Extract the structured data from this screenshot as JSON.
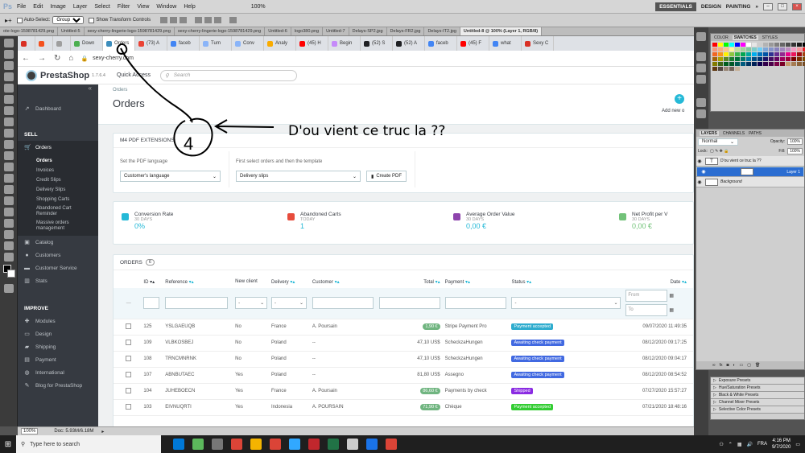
{
  "photoshop": {
    "menu": [
      "File",
      "Edit",
      "Image",
      "Layer",
      "Select",
      "Filter",
      "View",
      "Window",
      "Help"
    ],
    "zoom": "100%",
    "workspaces": [
      "ESSENTIALS",
      "DESIGN",
      "PAINTING"
    ],
    "options": {
      "auto_select": "Auto-Select:",
      "auto_select_value": "Group",
      "show_transform": "Show Transform Controls"
    },
    "doc_tabs": [
      "ote-logo-1598781429.png",
      "Untitled-5",
      "sexy-cherry-lingerie-logo-1598781429.png",
      "sexy-cherry-lingerie-logo-1598781429.png",
      "Untitled-6",
      "logo380.png",
      "Untitled-7",
      "Delays-SP2.jpg",
      "Delays-FR2.jpg",
      "Delays-IT2.jpg",
      "Untitled-8 @ 100% (Layer 1, RGB/8)"
    ],
    "status": {
      "zoom": "100%",
      "doc": "Doc: 5.93M/6.18M"
    },
    "panels": {
      "swatch_tabs": [
        "COLOR",
        "SWATCHES",
        "STYLES"
      ],
      "layer_tabs": [
        "LAYERS",
        "CHANNELS",
        "PATHS"
      ],
      "blend": "Normal",
      "opacity_label": "Opacity:",
      "opacity": "100%",
      "lock_label": "Lock:",
      "fill_label": "Fill:",
      "fill": "100%",
      "layers": [
        {
          "name": "D'ou vient ce truc la ??",
          "type": "T",
          "selected": false
        },
        {
          "name": "Layer 1",
          "type": "",
          "selected": true
        },
        {
          "name": "Background",
          "type": "",
          "selected": false
        }
      ],
      "presets": [
        "Exposure Presets",
        "Hue/Saturation Presets",
        "Black & White Presets",
        "Channel Mixer Presets",
        "Selective Color Presets"
      ]
    },
    "swatch_colors": [
      "#ff0000",
      "#ffff00",
      "#00ff00",
      "#00ffff",
      "#0000ff",
      "#ff00ff",
      "#ffffff",
      "#e6e6e6",
      "#cccccc",
      "#b3b3b3",
      "#999999",
      "#808080",
      "#666666",
      "#4d4d4d",
      "#333333",
      "#1a1a1a",
      "#000000",
      "#f7977a",
      "#f9ad81",
      "#fdc68a",
      "#fff79a",
      "#c4df9b",
      "#a2d39c",
      "#82ca9d",
      "#7bcdc8",
      "#6ecff6",
      "#7ea7d8",
      "#8493ca",
      "#8882be",
      "#a187be",
      "#bc8dbf",
      "#f49ac2",
      "#f6989d",
      "#ed1c24",
      "#f26522",
      "#f7941d",
      "#fff200",
      "#8dc63f",
      "#39b54a",
      "#00a651",
      "#00a99d",
      "#00aeef",
      "#0072bc",
      "#0054a6",
      "#2e3192",
      "#662d91",
      "#92278f",
      "#ec008c",
      "#ed145b",
      "#9e0b0f",
      "#a0410d",
      "#a36209",
      "#aba000",
      "#598527",
      "#1a7b30",
      "#007236",
      "#00746b",
      "#0076a3",
      "#004a80",
      "#003471",
      "#1b1464",
      "#440e62",
      "#630460",
      "#9e005d",
      "#9e0039",
      "#790000",
      "#7b2e00",
      "#7d4900",
      "#827b00",
      "#406618",
      "#005e20",
      "#005826",
      "#005952",
      "#005b7f",
      "#003663",
      "#002157",
      "#0d004c",
      "#32004b",
      "#4b0049",
      "#7b0046",
      "#7a0026",
      "#c69c6d",
      "#a67c52",
      "#8c6239",
      "#754c24",
      "#603913",
      "#534741",
      "#998675",
      "#736357",
      "#c7b299"
    ]
  },
  "annotation": {
    "number": "4",
    "text": "D'ou vient ce truc la ??"
  },
  "browser": {
    "tabs": [
      {
        "label": "",
        "color": "#d93025"
      },
      {
        "label": "",
        "color": "#f4511e"
      },
      {
        "label": "",
        "color": "#9e9e9e"
      },
      {
        "label": "Down",
        "color": "#4caf50"
      },
      {
        "label": "Orders",
        "color": "#3c8dbc"
      },
      {
        "label": "(73) A",
        "color": "#ea4335"
      },
      {
        "label": "faceb",
        "color": "#4285f4"
      },
      {
        "label": "Turn",
        "color": "#8ab4f8"
      },
      {
        "label": "Conv",
        "color": "#8ab4f8"
      },
      {
        "label": "Analy",
        "color": "#f9ab00"
      },
      {
        "label": "(45) H",
        "color": "#ff0000"
      },
      {
        "label": "Begin",
        "color": "#c58af9"
      },
      {
        "label": "(52) S",
        "color": "#202124"
      },
      {
        "label": "(52) A",
        "color": "#202124"
      },
      {
        "label": "faceb",
        "color": "#4285f4"
      },
      {
        "label": "(45) F",
        "color": "#ff0000"
      },
      {
        "label": "what",
        "color": "#4285f4"
      },
      {
        "label": "Sexy C",
        "color": "#d93025"
      }
    ],
    "url": "sexy-cherry.com"
  },
  "prestashop": {
    "brand": "PrestaShop",
    "version": "1.7.6.4",
    "quick_access": "Quick Access",
    "search_placeholder": "Search",
    "breadcrumb": "Orders",
    "page_title": "Orders",
    "add_new": "Add new o",
    "sidebar": {
      "dashboard": "Dashboard",
      "sell": "SELL",
      "orders": "Orders",
      "order_subs": [
        "Orders",
        "Invoices",
        "Credit Slips",
        "Delivery Slips",
        "Shopping Carts",
        "Abandoned Cart Reminder",
        "Massive orders management"
      ],
      "catalog": "Catalog",
      "customers": "Customers",
      "customer_service": "Customer Service",
      "stats": "Stats",
      "improve": "IMPROVE",
      "improve_items": [
        "Modules",
        "Design",
        "Shipping",
        "Payment",
        "International",
        "Blog for PrestaShop"
      ]
    },
    "pdf": {
      "title": "M4 PDF EXTENSIONS",
      "lang_label": "Set the PDF language",
      "lang_value": "Customer's language",
      "tpl_label": "First select orders and then the template",
      "tpl_value": "Delivery slips",
      "create_button": "Create PDF"
    },
    "kpis": [
      {
        "title": "Conversion Rate",
        "sub": "30 DAYS",
        "value": "0%",
        "color": "#25b9d7"
      },
      {
        "title": "Abandoned Carts",
        "sub": "TODAY",
        "value": "1",
        "color": "#e74c3c"
      },
      {
        "title": "Average Order Value",
        "sub": "30 DAYS",
        "value": "0,00 €",
        "color": "#8e44ad"
      },
      {
        "title": "Net Profit per V",
        "sub": "30 DAYS",
        "value": "0,00 €",
        "color": "#72c279"
      }
    ],
    "orders": {
      "title": "ORDERS",
      "count": "6",
      "columns": [
        "ID",
        "Reference",
        "New client",
        "Delivery",
        "Customer",
        "Total",
        "Payment",
        "Status",
        "Date"
      ],
      "filters": {
        "from": "From",
        "to": "To",
        "dash": "-"
      },
      "rows": [
        {
          "id": "125",
          "ref": "YSLGAEUQB",
          "new": "No",
          "delivery": "France",
          "customer": "A. Poursain",
          "total": "1,90 €",
          "total_badge": true,
          "payment": "Stripe Payment Pro",
          "status": "Payment accepted",
          "status_color": "#2eacce",
          "date": "09/07/2020 11:49:35"
        },
        {
          "id": "109",
          "ref": "VLBKOSBEJ",
          "new": "No",
          "delivery": "Poland",
          "customer": "--",
          "total": "47,10 US$",
          "total_badge": false,
          "payment": "ScheckzaHungen",
          "status": "Awaiting check payment",
          "status_color": "#4169e1",
          "date": "08/12/2020 09:17:25"
        },
        {
          "id": "108",
          "ref": "TRNCMNRNK",
          "new": "No",
          "delivery": "Poland",
          "customer": "--",
          "total": "47,10 US$",
          "total_badge": false,
          "payment": "ScheckzaHungen",
          "status": "Awaiting check payment",
          "status_color": "#4169e1",
          "date": "08/12/2020 09:04:17"
        },
        {
          "id": "107",
          "ref": "ABNBUTAEC",
          "new": "Yes",
          "delivery": "Poland",
          "customer": "--",
          "total": "81,80 US$",
          "total_badge": false,
          "payment": "Assegno",
          "status": "Awaiting check payment",
          "status_color": "#4169e1",
          "date": "08/12/2020 08:54:52"
        },
        {
          "id": "104",
          "ref": "JUHEBOECN",
          "new": "Yes",
          "delivery": "France",
          "customer": "A. Poursain",
          "total": "86,60 €",
          "total_badge": true,
          "payment": "Payments by check",
          "status": "Shipped",
          "status_color": "#8a2be2",
          "date": "07/27/2020 15:57:27"
        },
        {
          "id": "103",
          "ref": "EIVNUQRTI",
          "new": "Yes",
          "delivery": "Indonesia",
          "customer": "A. POURSAIN",
          "total": "71,90 €",
          "total_badge": true,
          "payment": "Chèque",
          "status": "Payment accepted",
          "status_color": "#32cd32",
          "date": "07/21/2020 18:48:16"
        }
      ]
    }
  },
  "taskbar": {
    "search_placeholder": "Type here to search",
    "lang": "FRA",
    "time": "4:16 PM",
    "date": "9/7/2020",
    "apps": [
      "#0078d7",
      "#5cb85c",
      "#777777",
      "#db4437",
      "#f4b400",
      "#db4437",
      "#31a8ff",
      "#c1272d",
      "#217346",
      "#cccccc",
      "#1a73e8",
      "#db4437"
    ]
  }
}
